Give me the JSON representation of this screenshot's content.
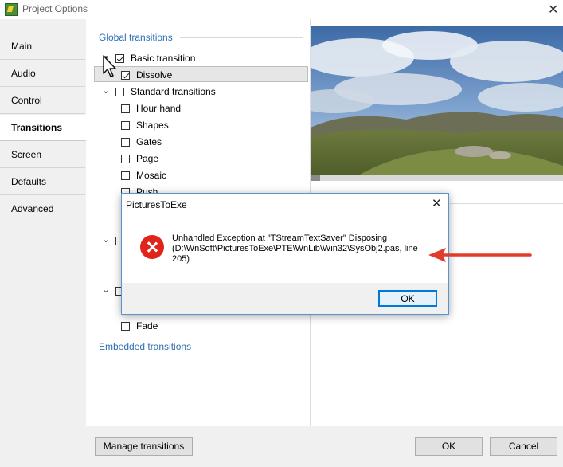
{
  "window": {
    "title": "Project Options"
  },
  "sidebar": {
    "items": [
      {
        "label": "Main",
        "active": false
      },
      {
        "label": "Audio",
        "active": false
      },
      {
        "label": "Control",
        "active": false
      },
      {
        "label": "Transitions",
        "active": true
      },
      {
        "label": "Screen",
        "active": false
      },
      {
        "label": "Defaults",
        "active": false
      },
      {
        "label": "Advanced",
        "active": false
      }
    ]
  },
  "transitions": {
    "global_heading": "Global transitions",
    "embedded_heading": "Embedded transitions",
    "basic": {
      "label": "Basic transition",
      "checked": true
    },
    "dissolve": {
      "label": "Dissolve",
      "checked": true
    },
    "standard": {
      "label": "Standard transitions",
      "checked": false,
      "items": [
        "Hour hand",
        "Shapes",
        "Gates",
        "Page",
        "Mosaic",
        "Push"
      ]
    },
    "fade": {
      "label": "Fade",
      "checked": false
    }
  },
  "buttons": {
    "manage": "Manage transitions",
    "ok": "OK",
    "cancel": "Cancel"
  },
  "dialog": {
    "title": "PicturesToExe",
    "message": "Unhandled Exception at \"TStreamTextSaver\" Disposing (D:\\WnSoft\\PicturesToExe\\PTE\\WnLib\\Win32\\SysObj2.pas, line 205)",
    "ok": "OK",
    "icon": "error-icon"
  },
  "colors": {
    "accent_text": "#2f6fb3",
    "error_red": "#e2231a",
    "arrow_red": "#e03c2b",
    "focus_blue": "#0078d7"
  }
}
